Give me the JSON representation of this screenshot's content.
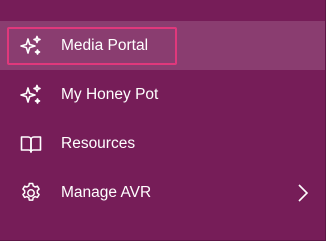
{
  "menu": {
    "items": [
      {
        "label": "Media Portal",
        "icon": "sparkles-icon",
        "highlighted": true,
        "has_submenu": false
      },
      {
        "label": "My Honey Pot",
        "icon": "sparkles-icon",
        "highlighted": false,
        "has_submenu": false
      },
      {
        "label": "Resources",
        "icon": "open-book-icon",
        "highlighted": false,
        "has_submenu": false
      },
      {
        "label": "Manage AVR",
        "icon": "gear-icon",
        "highlighted": false,
        "has_submenu": true
      }
    ]
  },
  "colors": {
    "menu_background": "#761d58",
    "highlight_background": "#8a3d70",
    "focus_outline": "#e0387c",
    "text": "#ffffff"
  }
}
